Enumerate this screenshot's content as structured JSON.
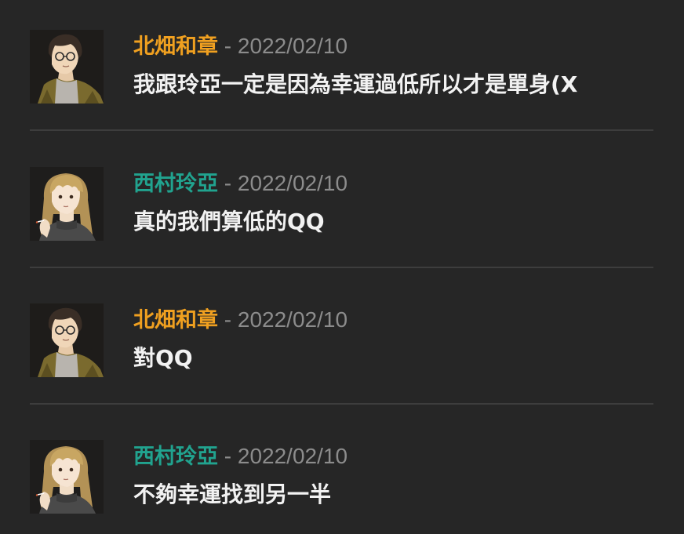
{
  "comments": [
    {
      "author": "北畑和章",
      "separator": " - ",
      "date": "2022/02/10",
      "text": "我跟玲亞一定是因為幸運過低所以才是單身(X",
      "author_color": "#f0a020",
      "avatar": "man-glasses-avatar"
    },
    {
      "author": "西村玲亞",
      "separator": " - ",
      "date": "2022/02/10",
      "text": "真的我們算低的QQ",
      "author_color": "#21a38f",
      "avatar": "woman-long-hair-avatar"
    },
    {
      "author": "北畑和章",
      "separator": " - ",
      "date": "2022/02/10",
      "text": "對QQ",
      "author_color": "#f0a020",
      "avatar": "man-glasses-avatar"
    },
    {
      "author": "西村玲亞",
      "separator": " - ",
      "date": "2022/02/10",
      "text": "不夠幸運找到另一半",
      "author_color": "#21a38f",
      "avatar": "woman-long-hair-avatar"
    }
  ]
}
